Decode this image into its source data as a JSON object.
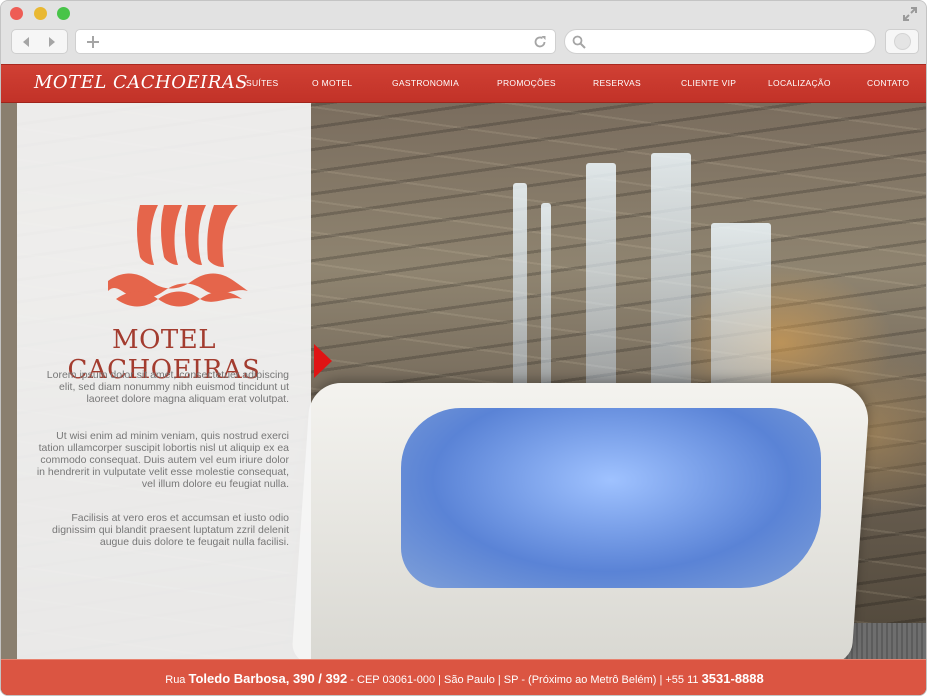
{
  "browser": {
    "icons": [
      "expand-icon",
      "back-arrow-icon",
      "forward-arrow-icon",
      "plus-icon",
      "reload-icon",
      "search-icon"
    ]
  },
  "site": {
    "logo": "MOTEL CACHOEIRAS",
    "menu": [
      "SUÍTES",
      "O MOTEL",
      "GASTRONOMIA",
      "PROMOÇÕES",
      "RESERVAS",
      "CLIENTE VIP",
      "LOCALIZAÇÃO",
      "CONTATO"
    ],
    "brand_name": "MOTEL CACHOEIRAS",
    "paragraphs": [
      "Lorem ipsum dolor sit amet, consectetuer adipiscing elit, sed diam nonummy nibh euismod tincidunt ut laoreet dolore magna aliquam erat volutpat.",
      "Ut wisi enim ad minim veniam, quis nostrud exerci tation ullamcorper suscipit lobortis nisl ut aliquip ex ea commodo consequat. Duis autem vel eum iriure dolor in hendrerit in vulputate velit esse molestie consequat, vel illum dolore eu feugiat nulla.",
      "Facilisis at vero eros et accumsan et iusto odio dignissim qui blandit praesent luptatum zzril delenit augue duis dolore te feugait nulla facilisi."
    ],
    "footer": {
      "rua_label": "Rua",
      "street": "Toledo Barbosa, 390 / 392",
      "details": "- CEP 03061-000 | São Paulo | SP - (Próximo ao Metrô Belém) | +55 11",
      "phone": "3531-8888"
    },
    "colors": {
      "header": "#c8382d",
      "footer": "#db5542",
      "brand": "#a33c2f",
      "slider_arrow": "#e01414"
    }
  }
}
